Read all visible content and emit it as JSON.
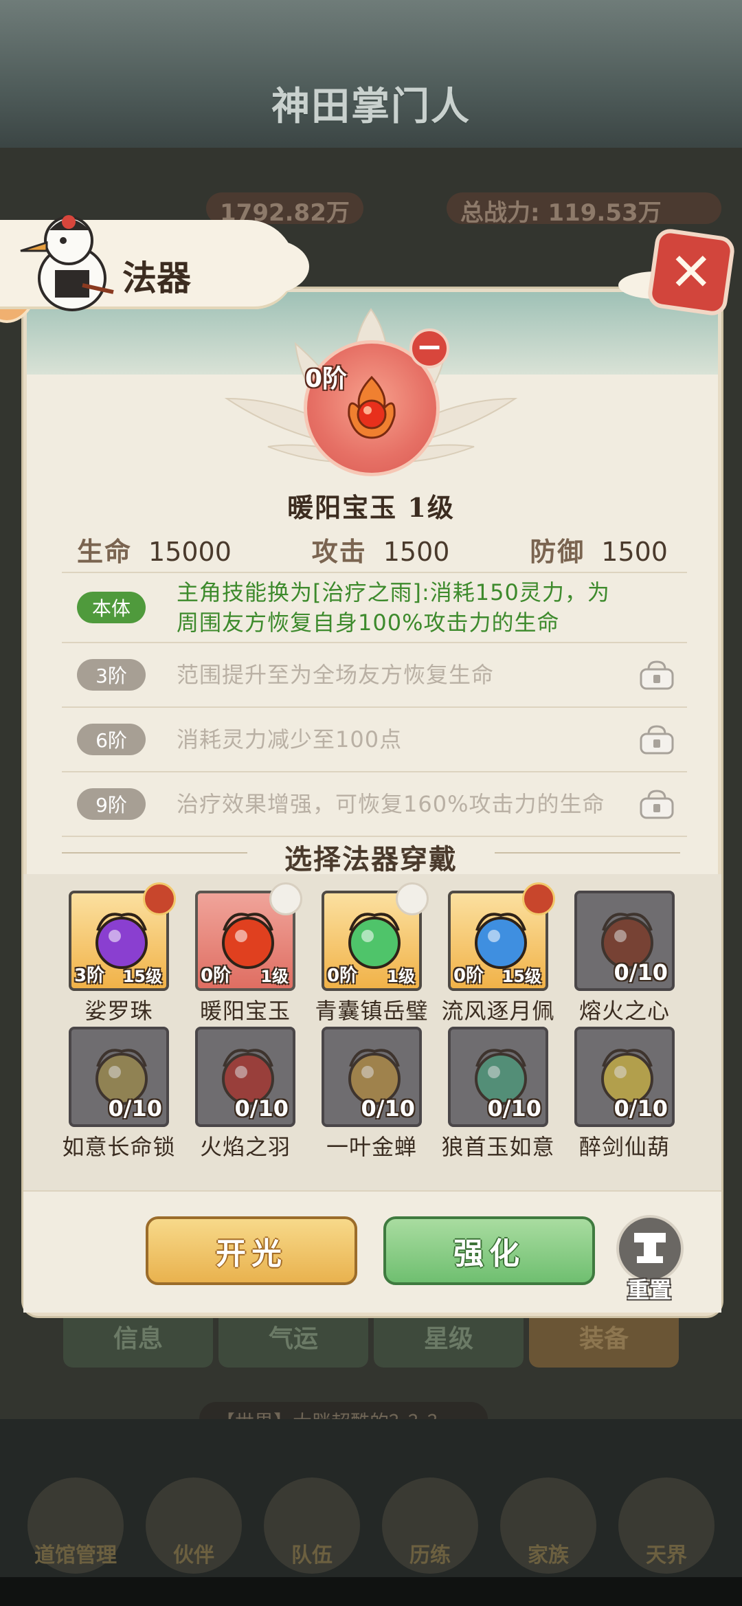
{
  "background": {
    "game_title": "神田掌门人",
    "stat_left": "1792.82万",
    "stat_right_label": "总战力:",
    "stat_right_value": "119.53万",
    "tabs": [
      "信息",
      "气运",
      "星级",
      "装备"
    ],
    "chat": "【世界】大胖超酷的？？？",
    "nav": [
      "道馆管理",
      "伙伴",
      "队伍",
      "历练",
      "家族",
      "天界"
    ]
  },
  "dialog": {
    "title": "法器",
    "close_icon": "close-icon",
    "selected": {
      "tier": "0阶",
      "name": "暖阳宝玉 1级"
    },
    "stats": [
      {
        "label": "生命",
        "value": "15000"
      },
      {
        "label": "攻击",
        "value": "1500"
      },
      {
        "label": "防御",
        "value": "1500"
      }
    ],
    "effects": [
      {
        "badge": "本体",
        "text": "主角技能换为[治疗之雨]:消耗150灵力，为周围友方恢复自身100%攻击力的生命",
        "active": true
      },
      {
        "badge": "3阶",
        "text": "范围提升至为全场友方恢复生命",
        "active": false
      },
      {
        "badge": "6阶",
        "text": "消耗灵力减少至100点",
        "active": false
      },
      {
        "badge": "9阶",
        "text": "治疗效果增强，可恢复160%攻击力的生命",
        "active": false
      }
    ],
    "section_title": "选择法器穿戴",
    "items": [
      {
        "name": "娑罗珠",
        "tier": "3阶",
        "level": "15级",
        "count": "",
        "style": "gold",
        "icon": "purple-orb-icon",
        "color": "#8a3fd0",
        "owner": "fire"
      },
      {
        "name": "暖阳宝玉",
        "tier": "0阶",
        "level": "1级",
        "count": "",
        "style": "red",
        "icon": "fire-jade-icon",
        "color": "#e0401f",
        "owner": "white"
      },
      {
        "name": "青囊镇岳璧",
        "tier": "0阶",
        "level": "1级",
        "count": "",
        "style": "gold",
        "icon": "green-jade-disc-icon",
        "color": "#4fc46a",
        "owner": "white"
      },
      {
        "name": "流风逐月佩",
        "tier": "0阶",
        "level": "15级",
        "count": "",
        "style": "gold",
        "icon": "blue-pendant-icon",
        "color": "#3f8fe0",
        "owner": "fire"
      },
      {
        "name": "熔火之心",
        "tier": "",
        "level": "",
        "count": "0/10",
        "style": "locked",
        "icon": "lava-heart-icon",
        "color": "#7a3520",
        "owner": ""
      },
      {
        "name": "如意长命锁",
        "tier": "",
        "level": "",
        "count": "0/10",
        "style": "locked",
        "icon": "longevity-lock-icon",
        "color": "#9b8a4a",
        "owner": ""
      },
      {
        "name": "火焰之羽",
        "tier": "",
        "level": "",
        "count": "0/10",
        "style": "locked",
        "icon": "flame-feather-icon",
        "color": "#a8302a",
        "owner": ""
      },
      {
        "name": "一叶金蝉",
        "tier": "",
        "level": "",
        "count": "0/10",
        "style": "locked",
        "icon": "golden-cicada-icon",
        "color": "#b08a40",
        "owner": ""
      },
      {
        "name": "狼首玉如意",
        "tier": "",
        "level": "",
        "count": "0/10",
        "style": "locked",
        "icon": "wolf-ruyi-icon",
        "color": "#4a9a7a",
        "owner": ""
      },
      {
        "name": "醉剑仙葫",
        "tier": "",
        "level": "",
        "count": "0/10",
        "style": "locked",
        "icon": "gourd-icon",
        "color": "#c9b040",
        "owner": ""
      }
    ],
    "buttons": {
      "open": "开光",
      "upgrade": "强化",
      "reset": "重置"
    }
  }
}
